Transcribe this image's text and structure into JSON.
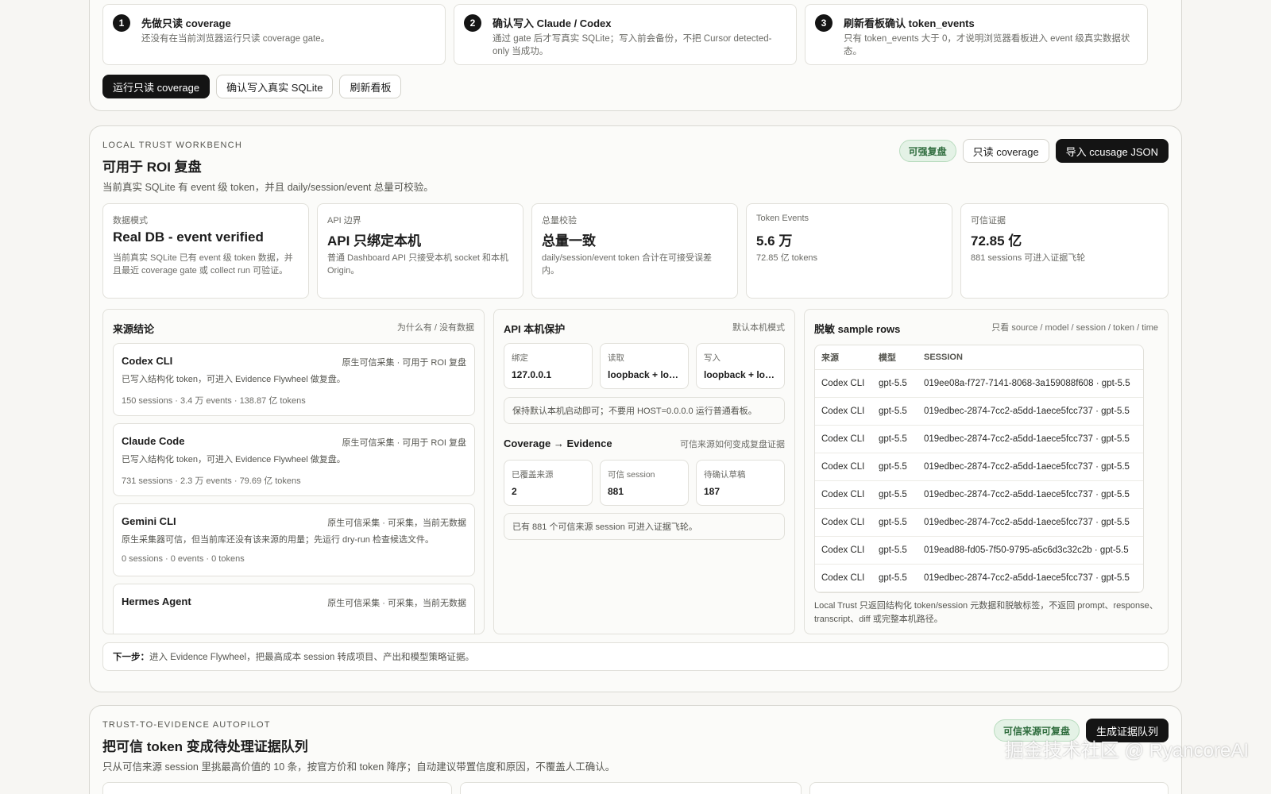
{
  "steps": [
    {
      "num": "1",
      "title": "先做只读 coverage",
      "desc": "还没有在当前浏览器运行只读 coverage gate。"
    },
    {
      "num": "2",
      "title": "确认写入 Claude / Codex",
      "desc": "通过 gate 后才写真实 SQLite；写入前会备份，不把 Cursor detected-only 当成功。"
    },
    {
      "num": "3",
      "title": "刷新看板确认 token_events",
      "desc": "只有 token_events 大于 0，才说明浏览器看板进入 event 级真实数据状态。"
    }
  ],
  "step_actions": {
    "run": "运行只读 coverage",
    "confirm": "确认写入真实 SQLite",
    "refresh": "刷新看板"
  },
  "workbench": {
    "eyebrow": "LOCAL TRUST WORKBENCH",
    "title": "可用于 ROI 复盘",
    "subtitle": "当前真实 SQLite 有 event 级 token，并且 daily/session/event 总量可校验。",
    "pill": "可强复盘",
    "btn_coverage": "只读 coverage",
    "btn_import": "导入 ccusage JSON",
    "metrics": [
      {
        "label": "数据模式",
        "value": "Real DB - event verified",
        "desc": "当前真实 SQLite 已有 event 级 token 数据，并且最近 coverage gate 或 collect run 可验证。"
      },
      {
        "label": "API 边界",
        "value": "API 只绑定本机",
        "desc": "普通 Dashboard API 只接受本机 socket 和本机 Origin。"
      },
      {
        "label": "总量校验",
        "value": "总量一致",
        "desc": "daily/session/event token 合计在可接受误差内。"
      },
      {
        "label": "Token Events",
        "value": "5.6 万",
        "desc": "72.85 亿 tokens"
      },
      {
        "label": "可信证据",
        "value": "72.85 亿",
        "desc": "881 sessions 可进入证据飞轮"
      }
    ],
    "sources": {
      "title": "来源结论",
      "hint": "为什么有 / 没有数据",
      "items": [
        {
          "name": "Codex CLI",
          "status": "原生可信采集 · 可用于 ROI 复盘",
          "desc": "已写入结构化 token，可进入 Evidence Flywheel 做复盘。",
          "stats": "150 sessions · 3.4 万 events · 138.87 亿 tokens"
        },
        {
          "name": "Claude Code",
          "status": "原生可信采集 · 可用于 ROI 复盘",
          "desc": "已写入结构化 token，可进入 Evidence Flywheel 做复盘。",
          "stats": "731 sessions · 2.3 万 events · 79.69 亿 tokens"
        },
        {
          "name": "Gemini CLI",
          "status": "原生可信采集 · 可采集，当前无数据",
          "desc": "原生采集器可信，但当前库还没有该来源的用量；先运行 dry-run 检查候选文件。",
          "stats": "0 sessions · 0 events · 0 tokens"
        },
        {
          "name": "Hermes Agent",
          "status": "原生可信采集 · 可采集，当前无数据",
          "desc": "",
          "stats": ""
        }
      ]
    },
    "api": {
      "title": "API 本机保护",
      "hint": "默认本机模式",
      "bind_label": "绑定",
      "bind_value": "127.0.0.1",
      "read_label": "读取",
      "read_value": "loopback + local origin",
      "write_label": "写入",
      "write_value": "loopback + local origin",
      "note": "保持默认本机启动即可；不要用 HOST=0.0.0.0 运行普通看板。"
    },
    "coverage": {
      "title": "Coverage → Evidence",
      "hint": "可信来源如何变成复盘证据",
      "covered_label": "已覆盖来源",
      "covered_value": "2",
      "trusted_label": "可信 session",
      "trusted_value": "881",
      "pending_label": "待确认草稿",
      "pending_value": "187",
      "note": "已有 881 个可信来源 session 可进入证据飞轮。"
    },
    "samples": {
      "title": "脱敏 sample rows",
      "hint": "只看 source / model / session / token / time",
      "headers": [
        "来源",
        "模型",
        "SESSION"
      ],
      "rows": [
        [
          "Codex CLI",
          "gpt-5.5",
          "019ee08a-f727-7141-8068-3a159088f608 · gpt-5.5"
        ],
        [
          "Codex CLI",
          "gpt-5.5",
          "019edbec-2874-7cc2-a5dd-1aece5fcc737 · gpt-5.5"
        ],
        [
          "Codex CLI",
          "gpt-5.5",
          "019edbec-2874-7cc2-a5dd-1aece5fcc737 · gpt-5.5"
        ],
        [
          "Codex CLI",
          "gpt-5.5",
          "019edbec-2874-7cc2-a5dd-1aece5fcc737 · gpt-5.5"
        ],
        [
          "Codex CLI",
          "gpt-5.5",
          "019edbec-2874-7cc2-a5dd-1aece5fcc737 · gpt-5.5"
        ],
        [
          "Codex CLI",
          "gpt-5.5",
          "019edbec-2874-7cc2-a5dd-1aece5fcc737 · gpt-5.5"
        ],
        [
          "Codex CLI",
          "gpt-5.5",
          "019ead88-fd05-7f50-9795-a5c6d3c32c2b · gpt-5.5"
        ],
        [
          "Codex CLI",
          "gpt-5.5",
          "019edbec-2874-7cc2-a5dd-1aece5fcc737 · gpt-5.5"
        ]
      ],
      "footer": "Local Trust 只返回结构化 token/session 元数据和脱敏标签，不返回 prompt、response、transcript、diff 或完整本机路径。"
    },
    "next_label": "下一步：",
    "next_text": "进入 Evidence Flywheel，把最高成本 session 转成项目、产出和模型策略证据。"
  },
  "autopilot": {
    "eyebrow": "TRUST-TO-EVIDENCE AUTOPILOT",
    "title": "把可信 token 变成待处理证据队列",
    "subtitle": "只从可信来源 session 里挑最高价值的 10 条，按官方价和 token 降序；自动建议带置信度和原因，不覆盖人工确认。",
    "pill": "可信来源可复盘",
    "btn": "生成证据队列"
  },
  "watermark": "掘金技术社区 @ RyancoreAI"
}
